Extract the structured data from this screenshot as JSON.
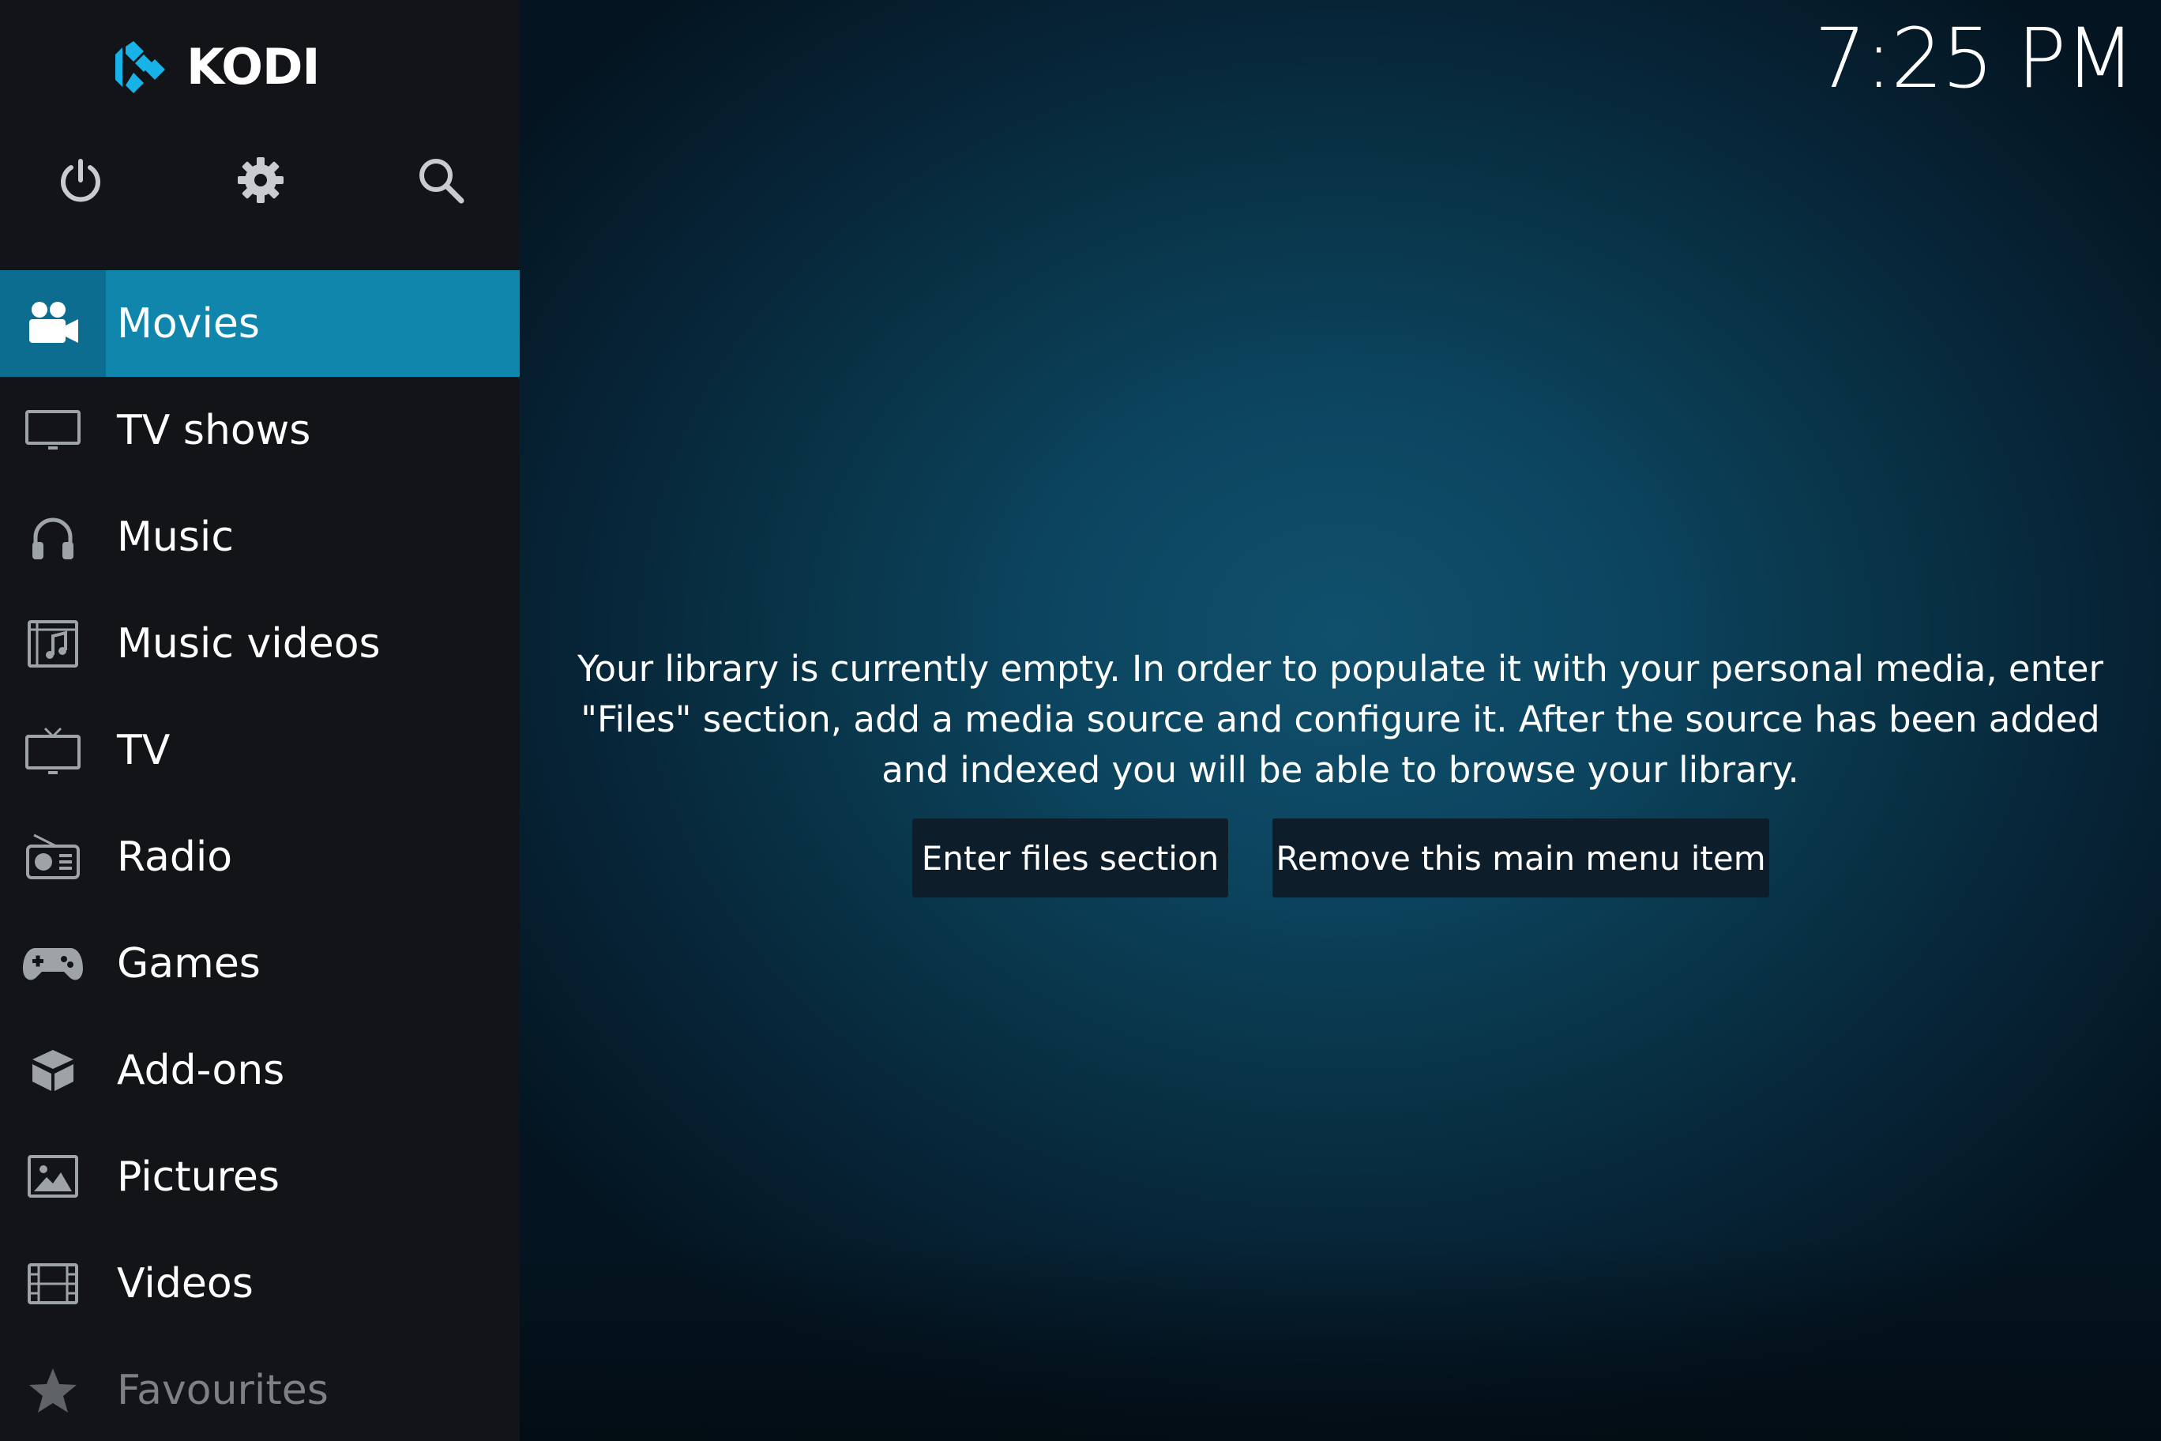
{
  "app": {
    "logo_text": "KODI",
    "clock": "7:25 PM"
  },
  "top_buttons": [
    {
      "icon": "power-icon"
    },
    {
      "icon": "gear-icon"
    },
    {
      "icon": "search-icon"
    }
  ],
  "menu": {
    "items": [
      {
        "label": "Movies",
        "icon": "movie-camera-icon",
        "active": true
      },
      {
        "label": "TV shows",
        "icon": "monitor-icon"
      },
      {
        "label": "Music",
        "icon": "headphones-icon"
      },
      {
        "label": "Music videos",
        "icon": "music-video-icon"
      },
      {
        "label": "TV",
        "icon": "tv-icon"
      },
      {
        "label": "Radio",
        "icon": "radio-icon"
      },
      {
        "label": "Games",
        "icon": "gamepad-icon"
      },
      {
        "label": "Add-ons",
        "icon": "addons-box-icon"
      },
      {
        "label": "Pictures",
        "icon": "picture-icon"
      },
      {
        "label": "Videos",
        "icon": "film-icon"
      },
      {
        "label": "Favourites",
        "icon": "star-icon"
      }
    ]
  },
  "main": {
    "message": "Your library is currently empty. In order to populate it with your personal media, enter \"Files\" section, add a media source and configure it. After the source has been added and indexed you will be able to browse your library.",
    "buttons": {
      "enter_files": "Enter files section",
      "remove_item": "Remove this main menu item"
    }
  },
  "colors": {
    "accent": "#1186ad",
    "sidebar_bg": "#121417",
    "button_bg": "#0d1e2a",
    "logo_blue": "#17b2e7"
  }
}
